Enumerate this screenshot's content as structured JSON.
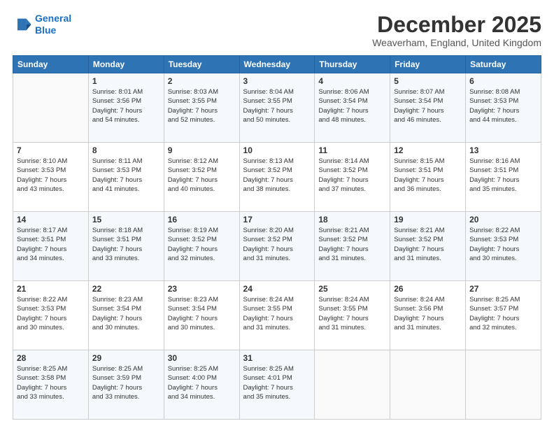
{
  "logo": {
    "line1": "General",
    "line2": "Blue"
  },
  "title": "December 2025",
  "subtitle": "Weaverham, England, United Kingdom",
  "days_of_week": [
    "Sunday",
    "Monday",
    "Tuesday",
    "Wednesday",
    "Thursday",
    "Friday",
    "Saturday"
  ],
  "weeks": [
    [
      {
        "day": "",
        "info": ""
      },
      {
        "day": "1",
        "info": "Sunrise: 8:01 AM\nSunset: 3:56 PM\nDaylight: 7 hours\nand 54 minutes."
      },
      {
        "day": "2",
        "info": "Sunrise: 8:03 AM\nSunset: 3:55 PM\nDaylight: 7 hours\nand 52 minutes."
      },
      {
        "day": "3",
        "info": "Sunrise: 8:04 AM\nSunset: 3:55 PM\nDaylight: 7 hours\nand 50 minutes."
      },
      {
        "day": "4",
        "info": "Sunrise: 8:06 AM\nSunset: 3:54 PM\nDaylight: 7 hours\nand 48 minutes."
      },
      {
        "day": "5",
        "info": "Sunrise: 8:07 AM\nSunset: 3:54 PM\nDaylight: 7 hours\nand 46 minutes."
      },
      {
        "day": "6",
        "info": "Sunrise: 8:08 AM\nSunset: 3:53 PM\nDaylight: 7 hours\nand 44 minutes."
      }
    ],
    [
      {
        "day": "7",
        "info": ""
      },
      {
        "day": "8",
        "info": "Sunrise: 8:11 AM\nSunset: 3:53 PM\nDaylight: 7 hours\nand 41 minutes."
      },
      {
        "day": "9",
        "info": "Sunrise: 8:12 AM\nSunset: 3:52 PM\nDaylight: 7 hours\nand 40 minutes."
      },
      {
        "day": "10",
        "info": "Sunrise: 8:13 AM\nSunset: 3:52 PM\nDaylight: 7 hours\nand 38 minutes."
      },
      {
        "day": "11",
        "info": "Sunrise: 8:14 AM\nSunset: 3:52 PM\nDaylight: 7 hours\nand 37 minutes."
      },
      {
        "day": "12",
        "info": "Sunrise: 8:15 AM\nSunset: 3:51 PM\nDaylight: 7 hours\nand 36 minutes."
      },
      {
        "day": "13",
        "info": "Sunrise: 8:16 AM\nSunset: 3:51 PM\nDaylight: 7 hours\nand 35 minutes."
      }
    ],
    [
      {
        "day": "14",
        "info": ""
      },
      {
        "day": "15",
        "info": "Sunrise: 8:18 AM\nSunset: 3:51 PM\nDaylight: 7 hours\nand 33 minutes."
      },
      {
        "day": "16",
        "info": "Sunrise: 8:19 AM\nSunset: 3:52 PM\nDaylight: 7 hours\nand 32 minutes."
      },
      {
        "day": "17",
        "info": "Sunrise: 8:20 AM\nSunset: 3:52 PM\nDaylight: 7 hours\nand 31 minutes."
      },
      {
        "day": "18",
        "info": "Sunrise: 8:21 AM\nSunset: 3:52 PM\nDaylight: 7 hours\nand 31 minutes."
      },
      {
        "day": "19",
        "info": "Sunrise: 8:21 AM\nSunset: 3:52 PM\nDaylight: 7 hours\nand 31 minutes."
      },
      {
        "day": "20",
        "info": "Sunrise: 8:22 AM\nSunset: 3:53 PM\nDaylight: 7 hours\nand 30 minutes."
      }
    ],
    [
      {
        "day": "21",
        "info": ""
      },
      {
        "day": "22",
        "info": "Sunrise: 8:23 AM\nSunset: 3:54 PM\nDaylight: 7 hours\nand 30 minutes."
      },
      {
        "day": "23",
        "info": "Sunrise: 8:23 AM\nSunset: 3:54 PM\nDaylight: 7 hours\nand 30 minutes."
      },
      {
        "day": "24",
        "info": "Sunrise: 8:24 AM\nSunset: 3:55 PM\nDaylight: 7 hours\nand 31 minutes."
      },
      {
        "day": "25",
        "info": "Sunrise: 8:24 AM\nSunset: 3:55 PM\nDaylight: 7 hours\nand 31 minutes."
      },
      {
        "day": "26",
        "info": "Sunrise: 8:24 AM\nSunset: 3:56 PM\nDaylight: 7 hours\nand 31 minutes."
      },
      {
        "day": "27",
        "info": "Sunrise: 8:25 AM\nSunset: 3:57 PM\nDaylight: 7 hours\nand 32 minutes."
      }
    ],
    [
      {
        "day": "28",
        "info": "Sunrise: 8:25 AM\nSunset: 3:58 PM\nDaylight: 7 hours\nand 33 minutes."
      },
      {
        "day": "29",
        "info": "Sunrise: 8:25 AM\nSunset: 3:59 PM\nDaylight: 7 hours\nand 33 minutes."
      },
      {
        "day": "30",
        "info": "Sunrise: 8:25 AM\nSunset: 4:00 PM\nDaylight: 7 hours\nand 34 minutes."
      },
      {
        "day": "31",
        "info": "Sunrise: 8:25 AM\nSunset: 4:01 PM\nDaylight: 7 hours\nand 35 minutes."
      },
      {
        "day": "",
        "info": ""
      },
      {
        "day": "",
        "info": ""
      },
      {
        "day": "",
        "info": ""
      }
    ]
  ],
  "week7_sunday": "Sunrise: 8:10 AM\nSunset: 3:53 PM\nDaylight: 7 hours\nand 43 minutes.",
  "week14_sunday": "Sunrise: 8:17 AM\nSunset: 3:51 PM\nDaylight: 7 hours\nand 34 minutes.",
  "week21_sunday": "Sunrise: 8:22 AM\nSunset: 3:53 PM\nDaylight: 7 hours\nand 30 minutes."
}
